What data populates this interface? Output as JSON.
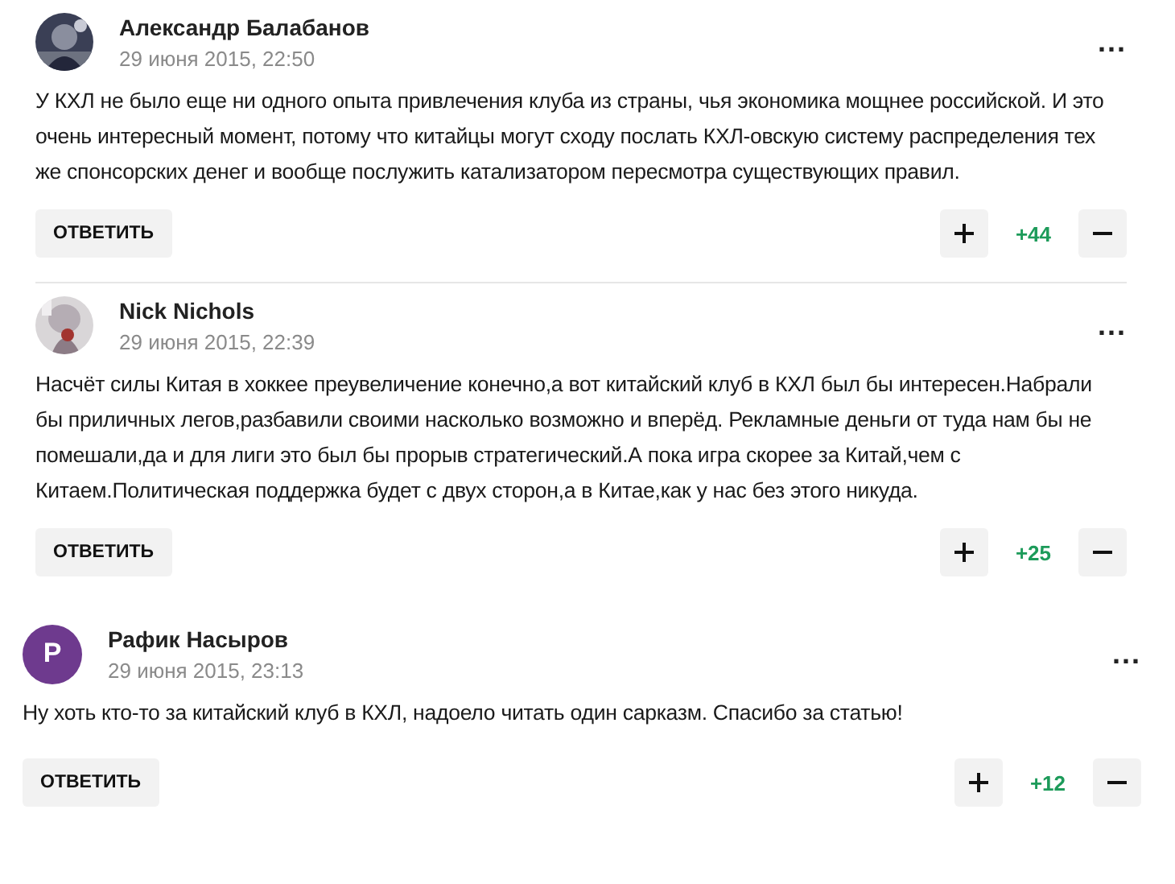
{
  "comments": [
    {
      "reply": true,
      "divider_after": true,
      "author": "Александр Балабанов",
      "date": "29 июня 2015, 22:50",
      "text": "У КХЛ не было еще ни одного опыта привлечения клуба из страны, чья экономика мощнее российской. И это очень интересный момент, потому что китайцы могут сходу послать КХЛ-овскую систему распределения тех же спонсорских денег и вообще послужить катализатором пересмотра существующих правил.",
      "reply_label": "ОТВЕТИТЬ",
      "score": "+44",
      "more": "..."
    },
    {
      "reply": true,
      "divider_after": false,
      "author": "Nick Nichols",
      "date": "29 июня 2015, 22:39",
      "text": "Насчёт силы Китая в хоккее преувеличение конечно,а вот китайский клуб в КХЛ был бы интересен.Набрали бы приличных легов,разбавили своими насколько возможно и вперёд. Рекламные деньги от туда нам бы не помешали,да и для лиги это был бы прорыв стратегический.А пока игра скорее за Китай,чем с Китаем.Политическая поддержка будет с двух сторон,а в Китае,как у нас без этого никуда.",
      "reply_label": "ОТВЕТИТЬ",
      "score": "+25",
      "more": "..."
    },
    {
      "reply": false,
      "divider_after": false,
      "avatar": {
        "kind": "letter",
        "letter": "Р",
        "color": "#6e3a8e"
      },
      "author": "Рафик Насыров",
      "date": "29 июня 2015, 23:13",
      "text": "Ну хоть кто-то за китайский клуб в КХЛ, надоело читать один сарказм. Спасибо за статью!",
      "reply_label": "ОТВЕТИТЬ",
      "score": "+12",
      "more": "..."
    }
  ]
}
